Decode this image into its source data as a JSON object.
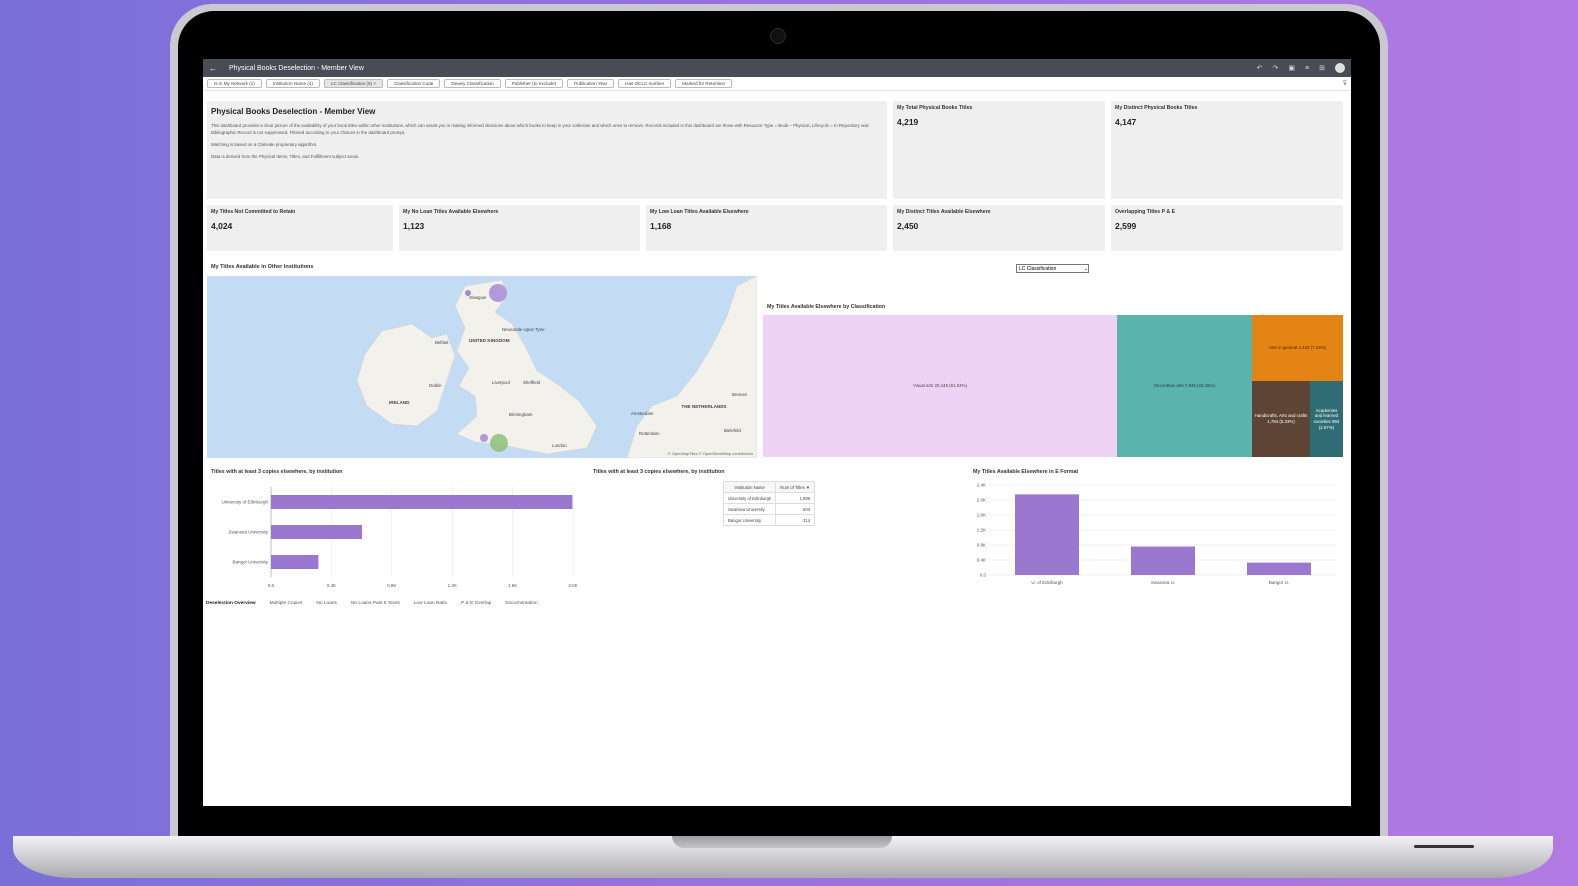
{
  "app": {
    "title": "Physical Books Deselection - Member View",
    "back_icon": "arrow-left-icon"
  },
  "filters": [
    {
      "label": "Is in My Network (1)",
      "active": false
    },
    {
      "label": "Institution Name (4)",
      "active": false
    },
    {
      "label": "LC Classification (5)",
      "active": true
    },
    {
      "label": "Classification Code",
      "active": false
    },
    {
      "label": "Dewey Classification",
      "active": false
    },
    {
      "label": "Publisher (to exclude)",
      "active": false
    },
    {
      "label": "Publication Year",
      "active": false
    },
    {
      "label": "Has OCLC number",
      "active": false
    },
    {
      "label": "Marked for Retention",
      "active": false
    }
  ],
  "intro": {
    "heading": "Physical Books Deselection - Member View",
    "p1": "This dashboard provides a clear picture of the availability of your book titles within other institutions, which can assist you in making informed decisions about which books to keep in your collection and which ones to remove. Records included in this dashboard are those with Resource Type = Book – Physical, Lifecycle = In Repository and Bibliographic Record is not suppressed. Filtered according to your choices in the dashboard prompt.",
    "p2": "Matching is based on a Clarivate proprietary algorithm.",
    "p3": "Data is derived from the Physical Items, Titles, and Fulfillment subject areas."
  },
  "kpis": {
    "total": {
      "label": "My Total Physical Books Titles",
      "value": "4,219"
    },
    "distinct": {
      "label": "My Distinct Physical Books Titles",
      "value": "4,147"
    },
    "not_committed": {
      "label": "My Titles Not Committed to Retain",
      "value": "4,024"
    },
    "no_loan": {
      "label": "My No Loan Titles Available Elsewhere",
      "value": "1,123"
    },
    "low_loan": {
      "label": "My Low Loan Titles Available Elsewhere",
      "value": "1,168"
    },
    "distinct_elsewhere": {
      "label": "My Distinct Titles Available Elsewhere",
      "value": "2,450"
    },
    "overlapping": {
      "label": "Overlapping Titles P & E",
      "value": "2,599"
    }
  },
  "map": {
    "title": "My Titles Available in Other Institutions",
    "labels": {
      "uk": "UNITED KINGDOM",
      "ireland": "IRELAND",
      "netherlands": "THE NETHERLANDS",
      "glasgow": "Glasgow",
      "newcastle": "Newcastle Upon Tyne",
      "belfast": "Belfast",
      "dublin": "Dublin",
      "liverpool": "Liverpool",
      "sheffield": "Sheffield",
      "birmingham": "Birmingham",
      "london": "London",
      "amsterdam": "Amsterdam",
      "rotterdam": "Rotterdam",
      "bremen": "Bremen",
      "bielefeld": "Bielefeld"
    },
    "credit": "© OpenMapTiles © OpenStreetMap contributors",
    "colors": {
      "water": "#c4dcf3",
      "land": "#f3f1ec",
      "bubble_purple": "#a78ad6",
      "bubble_green": "#8fc07a"
    }
  },
  "classification_select": {
    "value": "LC Classification"
  },
  "treemap": {
    "title": "My Titles Available Elsewhere by Classification",
    "cells": [
      {
        "label": "Visual arts 20,445 (61.04%)",
        "color": "#efd3f7",
        "text_color": "#444"
      },
      {
        "label": "Decorative arts 7,849 (23.45%)",
        "color": "#5ab3ad",
        "text_color": "#1a3e3c"
      },
      {
        "label": "Arts in general 2,424 (7.24%)",
        "color": "#e38414",
        "text_color": "#4a2600"
      },
      {
        "label": "Handicrafts. Arts and crafts 1,784 (5.33%)",
        "color": "#5e4434",
        "text_color": "#ffffff"
      },
      {
        "label": "Academies and learned societies 994 (2.97%)",
        "color": "#2f6d74",
        "text_color": "#ffffff"
      }
    ]
  },
  "bar_section": {
    "title": "Titles with at least 3 copies elsewhere, by institution"
  },
  "table_section": {
    "title": "Titles with at least 3 copies elsewhere, by institution",
    "headers": [
      "Institution Name",
      "Num of Titles ▼"
    ],
    "rows": [
      [
        "University of Edinburgh",
        "1,996"
      ],
      [
        "Swansea University",
        "603"
      ],
      [
        "Bangor University",
        "314"
      ]
    ]
  },
  "eformat_section": {
    "title": "My Titles Available Elsewhere in E Format"
  },
  "chart_data": [
    {
      "type": "bar",
      "orientation": "horizontal",
      "title": "Titles with at least 3 copies elsewhere, by institution",
      "categories": [
        "University of Edinburgh",
        "Swansea University",
        "Bangor University"
      ],
      "values": [
        1996,
        603,
        314
      ],
      "xticks": [
        "0.0",
        "0.4K",
        "0.8K",
        "1.2K",
        "1.6K",
        "2.0K"
      ],
      "xlim": [
        0,
        2000
      ],
      "color": "#9b78cf",
      "grid": true
    },
    {
      "type": "bar",
      "orientation": "vertical",
      "title": "My Titles Available Elsewhere in E Format",
      "categories": [
        "U. of Edinburgh",
        "Swansea U.",
        "Bangor U."
      ],
      "values": [
        2150,
        760,
        330
      ],
      "yticks": [
        "0.0",
        "0.4K",
        "0.8K",
        "1.2K",
        "1.6K",
        "2.0K",
        "2.4K"
      ],
      "ylim": [
        0,
        2400
      ],
      "color": "#9b78cf",
      "grid": true
    }
  ],
  "tabs": [
    {
      "label": "Deselection Overview",
      "active": true
    },
    {
      "label": "Multiple Copies",
      "active": false
    },
    {
      "label": "No Loans",
      "active": false
    },
    {
      "label": "No Loans Past 5 Years",
      "active": false
    },
    {
      "label": "Low Loan Ratio",
      "active": false
    },
    {
      "label": "P & E Overlap",
      "active": false
    },
    {
      "label": "Documentation",
      "active": false
    }
  ]
}
